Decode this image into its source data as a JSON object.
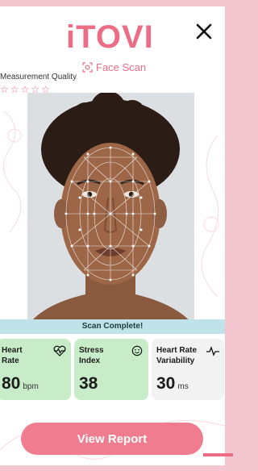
{
  "header": {
    "logo_text": "iTOVI",
    "subtitle": "Face Scan",
    "close_icon": "close-icon"
  },
  "measurement": {
    "label": "Measurement Quality",
    "stars_total": 5,
    "stars_filled": 0
  },
  "scan": {
    "status": "Scan Complete!"
  },
  "metrics": [
    {
      "label_line1": "Heart",
      "label_line2": "Rate",
      "value": "80",
      "unit": "bpm",
      "icon": "heartbeat-icon",
      "color": "#c8ecc8"
    },
    {
      "label_line1": "Stress",
      "label_line2": "Index",
      "value": "38",
      "unit": "",
      "icon": "smiley-icon",
      "color": "#c8ecc8"
    },
    {
      "label_line1": "Heart Rate",
      "label_line2": "Variability",
      "value": "30",
      "unit": "ms",
      "icon": "pulse-icon",
      "color": "#f2f2f2"
    }
  ],
  "actions": {
    "view_report": "View Report"
  },
  "colors": {
    "brand": "#ec6d86",
    "button": "#ef7d8f",
    "banner": "#bfe3e8",
    "metric_green": "#c8ecc8"
  }
}
